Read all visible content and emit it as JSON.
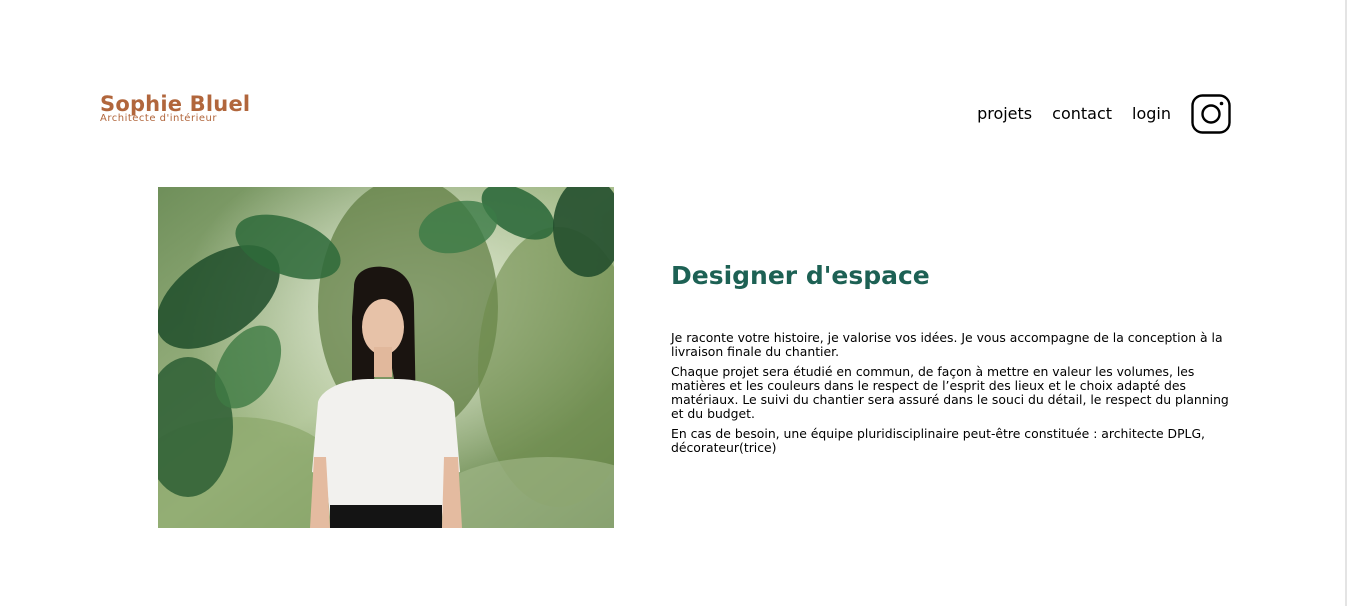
{
  "header": {
    "brand_name": "Sophie Bluel",
    "brand_tagline": "Architecte d'intérieur",
    "nav": {
      "projects": "projets",
      "contact": "contact",
      "login": "login"
    },
    "social_icon": "instagram-icon"
  },
  "intro": {
    "photo_icon": "portrait-photo",
    "title": "Designer d'espace",
    "paragraphs": [
      "Je raconte votre histoire, je valorise vos idées. Je vous accompagne de la conception à la livraison finale du chantier.",
      "Chaque projet sera étudié en commun, de façon à mettre en valeur les volumes, les matières et les couleurs dans le respect de l’esprit des lieux et le choix adapté des matériaux. Le suivi du chantier sera assuré dans le souci du détail, le respect du planning et du budget.",
      "En cas de besoin, une équipe pluridisciplinaire peut-être constituée : architecte DPLG, décorateur(trice)"
    ]
  },
  "colors": {
    "brand": "#b1663c",
    "title": "#1d6154",
    "text": "#000000",
    "background": "#ffffff"
  }
}
